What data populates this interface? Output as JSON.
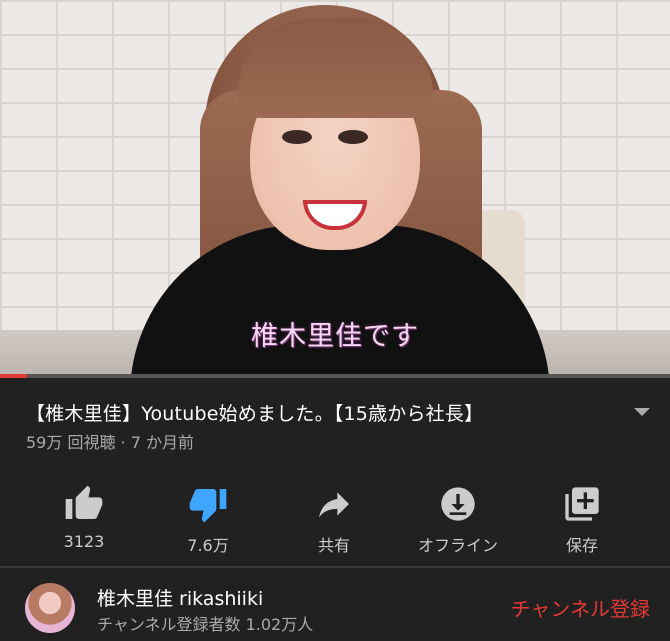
{
  "video": {
    "subtitle": "椎木里佳です",
    "progress_percent": 4
  },
  "info": {
    "title": "【椎木里佳】Youtube始めました。【15歳から社長】",
    "meta": "59万 回視聴 · 7 か月前"
  },
  "actions": [
    {
      "icon": "thumbs-up-icon",
      "label": "3123"
    },
    {
      "icon": "thumbs-down-icon",
      "label": "7.6万"
    },
    {
      "icon": "share-icon",
      "label": "共有"
    },
    {
      "icon": "download-icon",
      "label": "オフライン"
    },
    {
      "icon": "add-to-playlist-icon",
      "label": "保存"
    }
  ],
  "channel": {
    "name": "椎木里佳 rikashiiki",
    "subscribers": "チャンネル登録者数 1.02万人",
    "subscribe_label": "チャンネル登録"
  },
  "colors": {
    "background": "#212121",
    "accent_red": "#e53935",
    "dislike_blue": "#3ea6ff",
    "secondary_text": "#aaaaaa"
  }
}
